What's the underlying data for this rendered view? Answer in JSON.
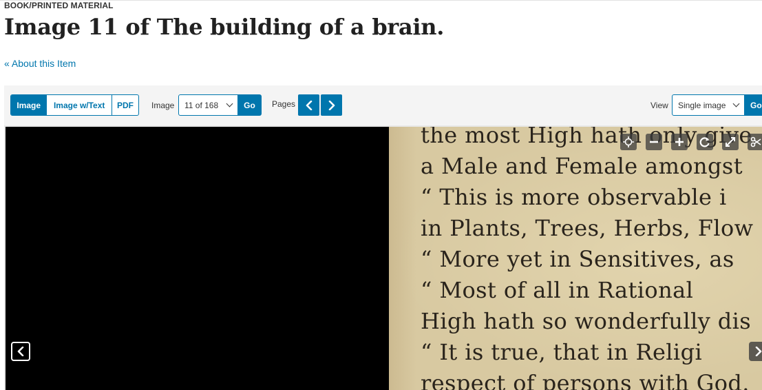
{
  "header": {
    "format_label": "BOOK/PRINTED MATERIAL",
    "title": "Image 11 of The building of a brain.",
    "about_link": "« About this Item"
  },
  "toolbar": {
    "view_modes": [
      {
        "label": "Image",
        "active": true
      },
      {
        "label": "Image w/Text",
        "active": false
      },
      {
        "label": "PDF",
        "active": false
      }
    ],
    "image_label": "Image",
    "image_select_value": "11 of 168",
    "image_go_label": "Go",
    "pages_label": "Pages",
    "view_label": "View",
    "view_select_value": "Single image",
    "view_go_label": "Go"
  },
  "viewer": {
    "scan_text_lines": [
      "the most High hath only give",
      "a Male and Female amongst",
      "  “ This is more observable i",
      "in Plants, Trees, Herbs, Flow",
      "  “ More yet in Sensitives, as",
      "  “ Most of all in Rational",
      "High hath so wonderfully dis",
      "  “ It is true, that in Religi",
      "respect of persons with God."
    ],
    "controls": [
      "move-icon",
      "zoom-out-icon",
      "zoom-in-icon",
      "rotate-icon",
      "fullscreen-icon",
      "clip-icon"
    ],
    "colors": {
      "accent": "#0076ad",
      "paper": "#d8c9a1",
      "ink": "#2a241c"
    }
  }
}
